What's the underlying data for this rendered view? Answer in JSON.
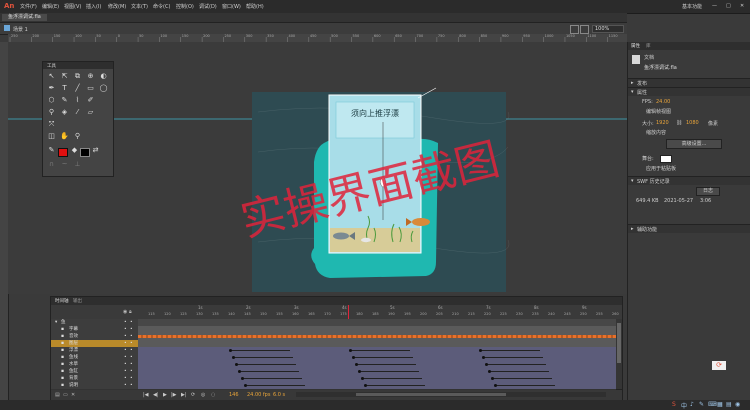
{
  "app": {
    "logo": "An",
    "workspace": "基本功能",
    "window_controls": [
      "—",
      "□",
      "✕"
    ]
  },
  "menu": [
    "文件(F)",
    "编辑(E)",
    "视图(V)",
    "插入(I)",
    "修改(M)",
    "文本(T)",
    "命令(C)",
    "控制(O)",
    "调试(D)",
    "窗口(W)",
    "帮助(H)"
  ],
  "document": {
    "tab": "鱼浮漂调试.fla",
    "scene": "场景 1",
    "zoom": "100%"
  },
  "ruler": {
    "top_ticks": [
      "250",
      "200",
      "150",
      "100",
      "50",
      "0",
      "50",
      "100",
      "150",
      "200",
      "250",
      "300",
      "350",
      "400",
      "450",
      "500",
      "550",
      "600",
      "650",
      "700",
      "750",
      "800",
      "850",
      "900",
      "950",
      "1000",
      "1050",
      "1100",
      "1150"
    ]
  },
  "stage": {
    "caption": "须向上推浮漂",
    "watermark": "实操界面截图",
    "colors": {
      "water": "#2e4b52",
      "teal": "#1fb8b0",
      "tank": "#a8dde8",
      "caption_bg": "#bfe8f0"
    }
  },
  "tools": {
    "title": "工具"
  },
  "timeline": {
    "tabs": [
      "时间轴",
      "输出"
    ],
    "frame_ticks": [
      "1s",
      "2s",
      "3s",
      "4s",
      "5s",
      "6s",
      "7s",
      "8s",
      "9s",
      "10s"
    ],
    "frame_numbers": [
      "115",
      "120",
      "125",
      "130",
      "135",
      "140",
      "145",
      "150",
      "155",
      "160",
      "165",
      "170",
      "175",
      "180",
      "185",
      "190",
      "195",
      "200",
      "205",
      "210",
      "215",
      "220",
      "225",
      "230",
      "235",
      "240",
      "245",
      "250",
      "255",
      "260"
    ],
    "layers": [
      {
        "name": "鱼",
        "type": "folder"
      },
      {
        "name": "字幕",
        "type": "layer"
      },
      {
        "name": "音效",
        "type": "layer"
      },
      {
        "name": "图层",
        "type": "layer",
        "selected": true
      },
      {
        "name": "浮漂",
        "type": "layer"
      },
      {
        "name": "鱼线",
        "type": "layer"
      },
      {
        "name": "水草",
        "type": "layer"
      },
      {
        "name": "鱼缸",
        "type": "layer"
      },
      {
        "name": "背景",
        "type": "layer"
      },
      {
        "name": "说明",
        "type": "layer"
      }
    ],
    "footer": {
      "frame": "146",
      "fps": "24.00 fps",
      "time": "6.0 s"
    }
  },
  "properties": {
    "tabs": [
      "属性",
      "库"
    ],
    "doc_label": "文档",
    "doc_name": "鱼浮漂调试.fla",
    "publish_section": "发布",
    "properties_section": "属性",
    "fps_label": "FPS:",
    "fps_value": "24.00",
    "edit_label": "编辑帧视图",
    "size_label": "大小:",
    "width": "1920",
    "height": "1080",
    "unit": "像素",
    "scale_label": "缩放内容",
    "advanced_button": "高级设置...",
    "stage_label": "舞台:",
    "stage_apply": "应用于粘贴板",
    "swf_section": "SWF 历史记录",
    "log_button": "日志",
    "swf_size": "649.4 KB",
    "swf_date": "2021-05-27",
    "swf_time": "3:06",
    "accessibility_section": "辅助功能"
  },
  "statusbar": {
    "icons": [
      "S",
      "中",
      "♪",
      "✎",
      "⌨",
      "▦",
      "▤",
      "◉"
    ]
  }
}
